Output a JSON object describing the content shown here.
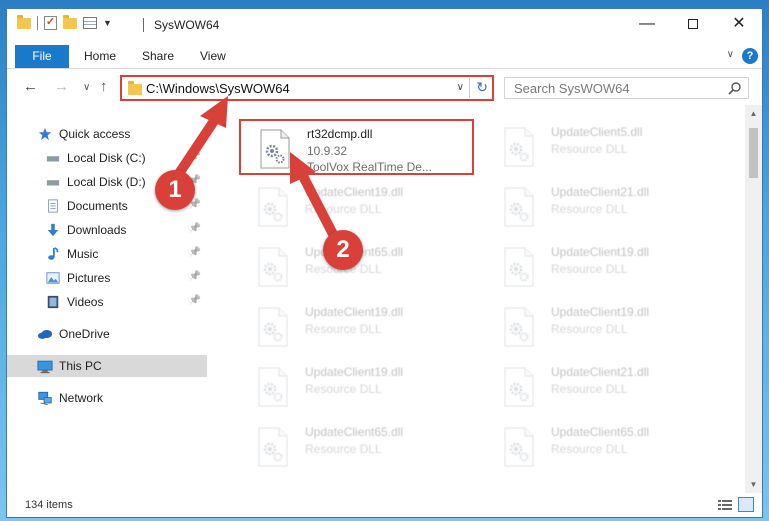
{
  "window": {
    "title": "SysWOW64",
    "minimize_label": "—",
    "close_label": "✕"
  },
  "ribbon": {
    "tabs": [
      "File",
      "Home",
      "Share",
      "View"
    ],
    "help_label": "?"
  },
  "address": {
    "path": "C:\\Windows\\SysWOW64",
    "search_placeholder": "Search SysWOW64"
  },
  "sidebar": {
    "items": [
      {
        "label": "Quick access",
        "icon": "star-icon",
        "pinned": false
      },
      {
        "label": "Local Disk (C:)",
        "icon": "drive-icon",
        "pinned": true
      },
      {
        "label": "Local Disk (D:)",
        "icon": "drive-icon",
        "pinned": true
      },
      {
        "label": "Documents",
        "icon": "documents-icon",
        "pinned": true
      },
      {
        "label": "Downloads",
        "icon": "download-icon",
        "pinned": true
      },
      {
        "label": "Music",
        "icon": "music-icon",
        "pinned": true
      },
      {
        "label": "Pictures",
        "icon": "pictures-icon",
        "pinned": true
      },
      {
        "label": "Videos",
        "icon": "videos-icon",
        "pinned": true
      },
      {
        "label": "OneDrive",
        "icon": "cloud-icon",
        "pinned": false
      },
      {
        "label": "This PC",
        "icon": "computer-icon",
        "pinned": false,
        "selected": true
      },
      {
        "label": "Network",
        "icon": "network-icon",
        "pinned": false
      }
    ]
  },
  "files": {
    "highlighted": {
      "name": "rt32dcmp.dll",
      "version": "10.9.32",
      "description": "ToolVox RealTime De..."
    },
    "faded": [
      {
        "name": "UpdateClient5.dll",
        "type": "Resource DLL"
      },
      {
        "name": "UpdateClient19.dll",
        "type": "Resource DLL"
      },
      {
        "name": "UpdateClient21.dll",
        "type": "Resource DLL"
      },
      {
        "name": "UpdateClient65.dll",
        "type": "Resource DLL"
      },
      {
        "name": "UpdateClient19.dll",
        "type": "Resource DLL"
      },
      {
        "name": "UpdateClient19.dll",
        "type": "Resource DLL"
      },
      {
        "name": "UpdateClient19.dll",
        "type": "Resource DLL"
      },
      {
        "name": "UpdateClient19.dll",
        "type": "Resource DLL"
      },
      {
        "name": "UpdateClient21.dll",
        "type": "Resource DLL"
      },
      {
        "name": "UpdateClient65.dll",
        "type": "Resource DLL"
      },
      {
        "name": "UpdateClient65.dll",
        "type": "Resource DLL"
      }
    ]
  },
  "status": {
    "item_count": "134 items"
  },
  "annotations": {
    "step1": "1",
    "step2": "2"
  },
  "colors": {
    "accent": "#1979ca",
    "highlight_red": "#d9403a",
    "folder_yellow": "#f3c64c",
    "selected_bg": "#d9d9d9"
  }
}
